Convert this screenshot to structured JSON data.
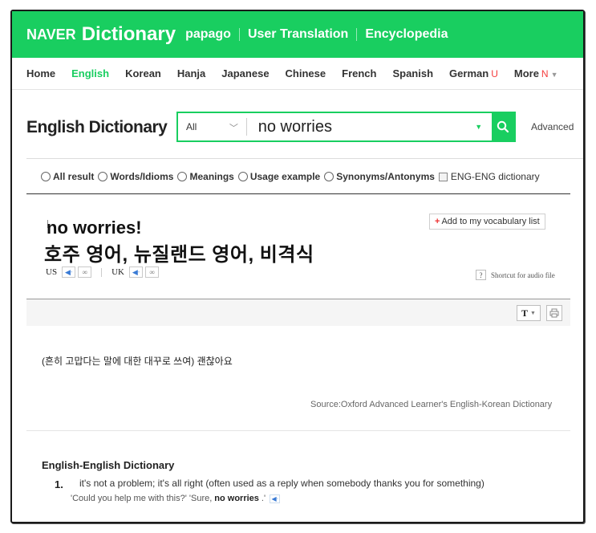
{
  "header": {
    "brand": "NAVER",
    "product": "Dictionary",
    "links": [
      "papago",
      "User Translation",
      "Encyclopedia"
    ]
  },
  "nav": {
    "items": [
      {
        "label": "Home",
        "active": false
      },
      {
        "label": "English",
        "active": true
      },
      {
        "label": "Korean",
        "active": false
      },
      {
        "label": "Hanja",
        "active": false
      },
      {
        "label": "Japanese",
        "active": false
      },
      {
        "label": "Chinese",
        "active": false
      },
      {
        "label": "French",
        "active": false
      },
      {
        "label": "Spanish",
        "active": false
      }
    ],
    "german": {
      "label": "German",
      "badge": "U"
    },
    "more": {
      "label": "More",
      "badge": "N"
    }
  },
  "search": {
    "page_title": "English Dictionary",
    "scope": "All",
    "query": "no worries",
    "advanced_label": "Advanced"
  },
  "filters": {
    "options": [
      "All result",
      "Words/Idioms",
      "Meanings",
      "Usage example",
      "Synonyms/Antonyms"
    ],
    "checkbox_label": "ENG-ENG dictionary"
  },
  "entry": {
    "headword": "no worries!",
    "region_label": "호주 영어, 뉴질랜드 영어, 비격식",
    "vocab_button": "Add to my vocabulary list",
    "pron_us": "US",
    "pron_uk": "UK",
    "shortcut_label": "Shortcut for audio file",
    "shortcut_key": "?",
    "meaning": "(흔히 고맙다는 말에 대한 대꾸로 쓰여) 괜찮아요",
    "source": "Source:Oxford Advanced Learner's English-Korean Dictionary"
  },
  "toolbar": {
    "font_button": "T"
  },
  "english_english": {
    "title": "English-English Dictionary",
    "number": "1.",
    "definition": "it's not a problem; it's all right (often used as a reply when somebody thanks you for something)",
    "example_before": "'Could you help me with this?' 'Sure,",
    "example_bold": "no worries",
    "example_after": ".'"
  },
  "colors": {
    "brand_green": "#19ce60",
    "badge_red": "#f53c3c",
    "link_blue": "#3a7bd5"
  }
}
